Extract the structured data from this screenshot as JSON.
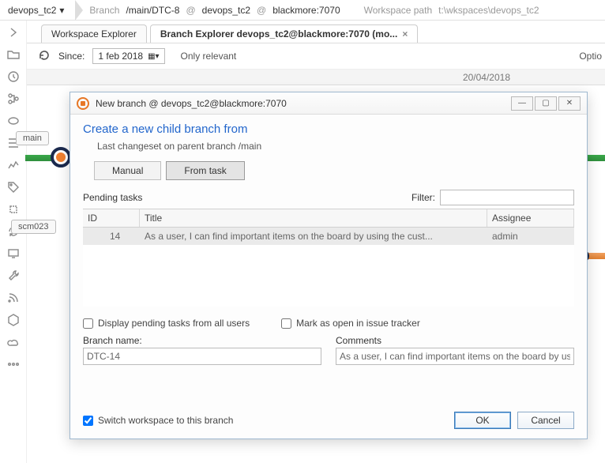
{
  "topbar": {
    "repo": "devops_tc2",
    "branch_label": "Branch",
    "branch_path": "/main/DTC-8",
    "at1": "@",
    "repo2": "devops_tc2",
    "at2": "@",
    "server": "blackmore:7070",
    "wspath_label": "Workspace path",
    "wspath": "t:\\wkspaces\\devops_tc2"
  },
  "tabs": {
    "explorer": "Workspace Explorer",
    "branchexp": "Branch Explorer devops_tc2@blackmore:7070 (mo..."
  },
  "toolbar": {
    "since": "Since:",
    "date": "1 feb  2018",
    "only_relevant": "Only relevant",
    "options": "Optio"
  },
  "ruler": {
    "date": "20/04/2018"
  },
  "canvas": {
    "main": "main",
    "scm": "scm023"
  },
  "dialog": {
    "title": "New branch @ devops_tc2@blackmore:7070",
    "heading": "Create a new child branch from",
    "sub": "Last changeset on parent branch /main",
    "manual": "Manual",
    "fromtask": "From task",
    "pending": "Pending tasks",
    "filter": "Filter:",
    "col_id": "ID",
    "col_title": "Title",
    "col_assignee": "Assignee",
    "row": {
      "id": "14",
      "title": "As a user, I can find important items on the board by using the cust...",
      "assignee": "admin"
    },
    "chk_all": "Display pending tasks from all users",
    "chk_open": "Mark as open in issue tracker",
    "branch_name_label": "Branch name:",
    "branch_name": "DTC-14",
    "comments_label": "Comments",
    "comments": "As a user, I can find important items on the board by usi",
    "chk_switch": "Switch workspace to this branch",
    "ok": "OK",
    "cancel": "Cancel"
  }
}
